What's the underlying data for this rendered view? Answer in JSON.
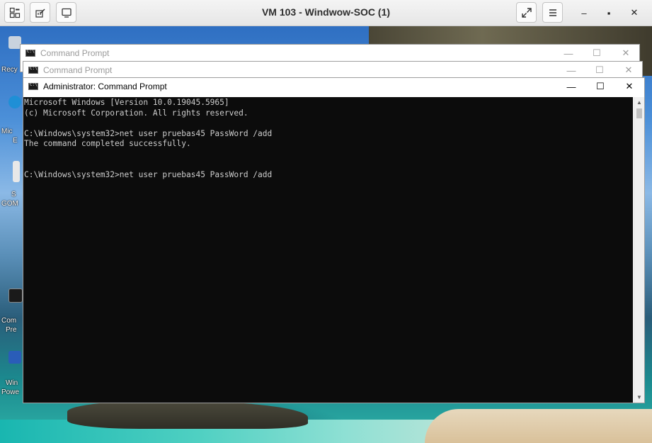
{
  "vm_viewer": {
    "title": "VM 103 - Windwow-SOC (1)",
    "toolbar_icons": [
      "windows-layout-icon",
      "edit-config-icon",
      "monitor-icon"
    ],
    "right_icons": [
      "fullscreen-icon",
      "menu-icon"
    ],
    "controls": {
      "minimize": "–",
      "maximize": "▪",
      "close": "✕"
    }
  },
  "desktop": {
    "icons": [
      {
        "label": "Recy",
        "icon": "recycle-bin-icon"
      },
      {
        "label": "Mic",
        "icon": "edge-icon"
      },
      {
        "label": "E",
        "icon": "edge-icon"
      },
      {
        "label": "S",
        "icon": "app-icon"
      },
      {
        "label": "GOM",
        "icon": "app-icon"
      },
      {
        "label": "Com",
        "icon": "cmd-shortcut-icon"
      },
      {
        "label": "Pre",
        "icon": "cmd-shortcut-icon"
      },
      {
        "label": "Win",
        "icon": "powershell-icon"
      },
      {
        "label": "Powe",
        "icon": "powershell-icon"
      }
    ]
  },
  "windows": [
    {
      "title": "Command Prompt",
      "state": "inactive"
    },
    {
      "title": "Command Prompt",
      "state": "inactive"
    },
    {
      "title": "Administrator: Command Prompt",
      "state": "active"
    }
  ],
  "window_controls": {
    "minimize": "—",
    "maximize": "☐",
    "close": "✕"
  },
  "console": {
    "lines": [
      "Microsoft Windows [Version 10.0.19045.5965]",
      "(c) Microsoft Corporation. All rights reserved.",
      "",
      "C:\\Windows\\system32>net user pruebas45 PassWord /add",
      "The command completed successfully.",
      "",
      "",
      "C:\\Windows\\system32>net user pruebas45 PassWord /add"
    ],
    "colors": {
      "background": "#0c0c0c",
      "text": "#cccccc"
    }
  },
  "scrollbar": {
    "up": "▲",
    "down": "▼"
  }
}
